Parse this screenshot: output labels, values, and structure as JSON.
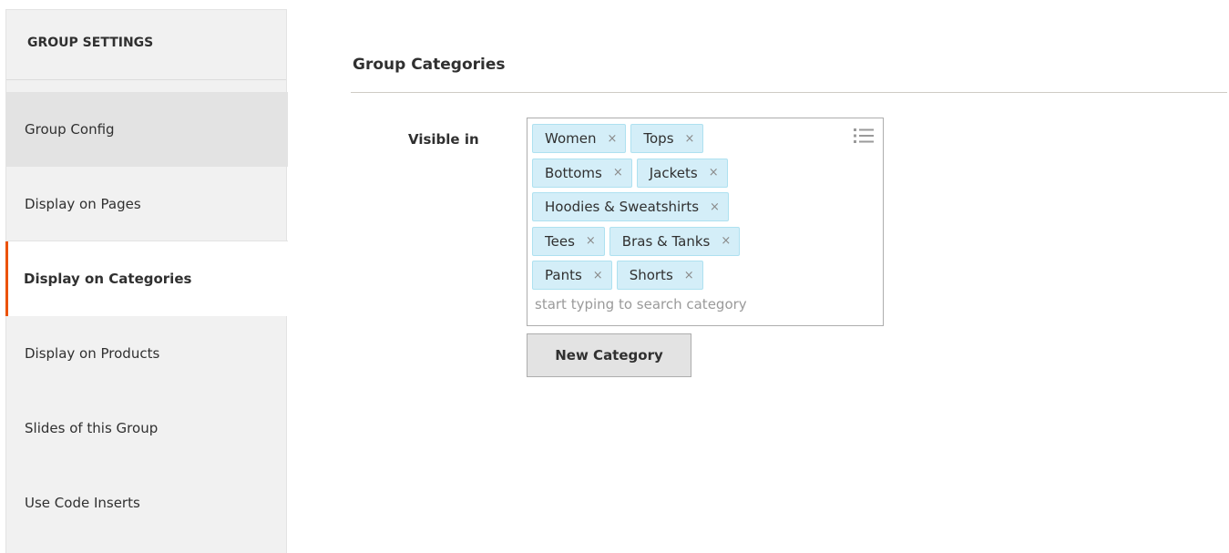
{
  "sidebar": {
    "title": "GROUP SETTINGS",
    "items": [
      {
        "label": "Group Config",
        "state": "hover"
      },
      {
        "label": "Display on Pages",
        "state": "normal"
      },
      {
        "label": "Display on Categories",
        "state": "active"
      },
      {
        "label": "Display on Products",
        "state": "normal"
      },
      {
        "label": "Slides of this Group",
        "state": "normal"
      },
      {
        "label": "Use Code Inserts",
        "state": "normal"
      }
    ]
  },
  "main": {
    "section_title": "Group Categories",
    "field_label": "Visible in",
    "tags": [
      {
        "label": "Women",
        "remove": "×"
      },
      {
        "label": "Tops",
        "remove": "×"
      },
      {
        "label": "Bottoms",
        "remove": "×"
      },
      {
        "label": "Jackets",
        "remove": "×"
      },
      {
        "label": "Hoodies & Sweatshirts",
        "remove": "×"
      },
      {
        "label": "Tees",
        "remove": "×"
      },
      {
        "label": "Bras & Tanks",
        "remove": "×"
      },
      {
        "label": "Pants",
        "remove": "×"
      },
      {
        "label": "Shorts",
        "remove": "×"
      }
    ],
    "search": {
      "value": "",
      "placeholder": "start typing to search category"
    },
    "list_icon": "list-icon",
    "new_category_label": "New Category"
  },
  "colors": {
    "accent": "#eb5202",
    "tag_bg": "#d4eef8",
    "tag_border": "#aee1f0",
    "sidebar_bg": "#f1f1f1"
  }
}
